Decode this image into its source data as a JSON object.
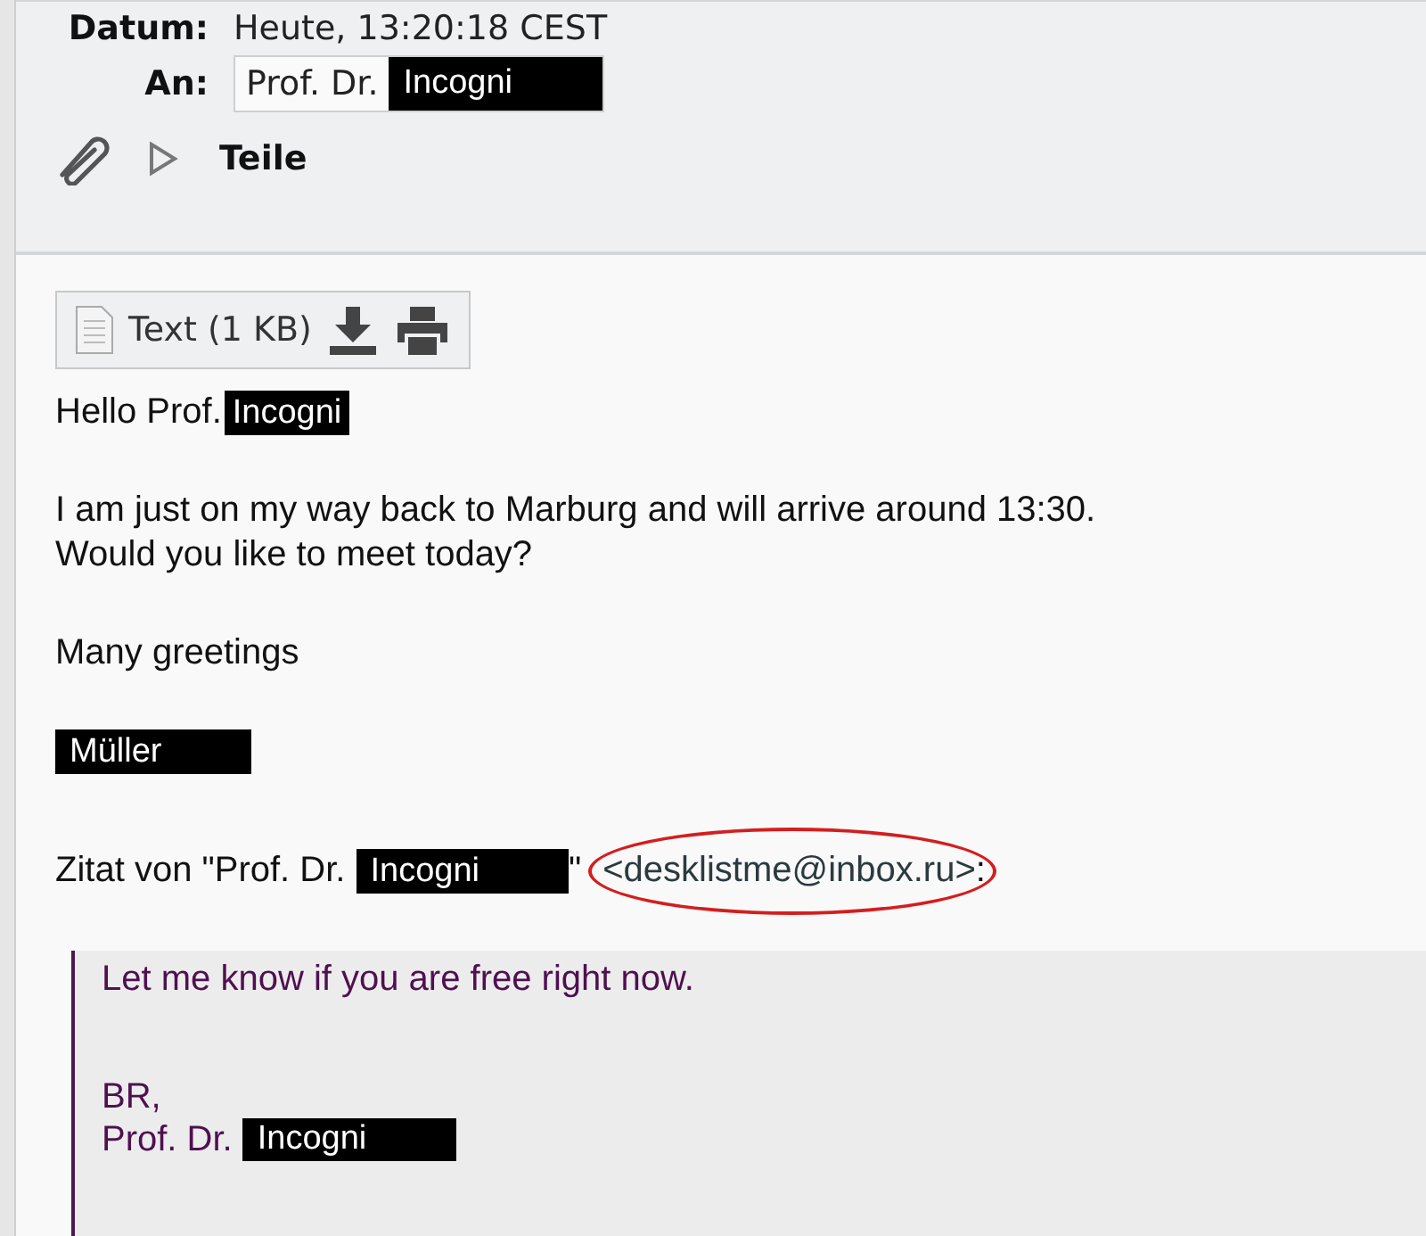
{
  "header": {
    "date": {
      "label": "Datum:",
      "value": "Heute, 13:20:18 CEST"
    },
    "to": {
      "label": "An:",
      "value": "Prof. Dr.",
      "redacted": "Incogni"
    },
    "parts": {
      "label": "Teile",
      "expanded": false
    }
  },
  "attachment": {
    "label": "Text (1 KB)"
  },
  "paragraphs": [
    [
      {
        "text": "Hello Prof.",
        "redacted": "Incogni"
      }
    ],
    [
      {
        "text": "I am just on my way back to Marburg and will arrive around 13:30."
      },
      {
        "text": "Would you like to meet today?"
      }
    ],
    [
      {
        "text": "Many greetings"
      }
    ],
    [
      {
        "redacted": "Müller"
      }
    ]
  ],
  "quote_header": {
    "text": "Zitat von \"Prof. Dr.",
    "redacted": "Incogni",
    "after": "\"",
    "email": "<desklistme@inbox.ru>",
    "end": ":",
    "circled": true
  },
  "quote": [
    [
      {
        "text": "Let me know if you are free right now."
      }
    ],
    [
      {
        "text": "BR,"
      },
      {
        "text": "Prof. Dr.",
        "redacted": "Incogni"
      }
    ]
  ]
}
